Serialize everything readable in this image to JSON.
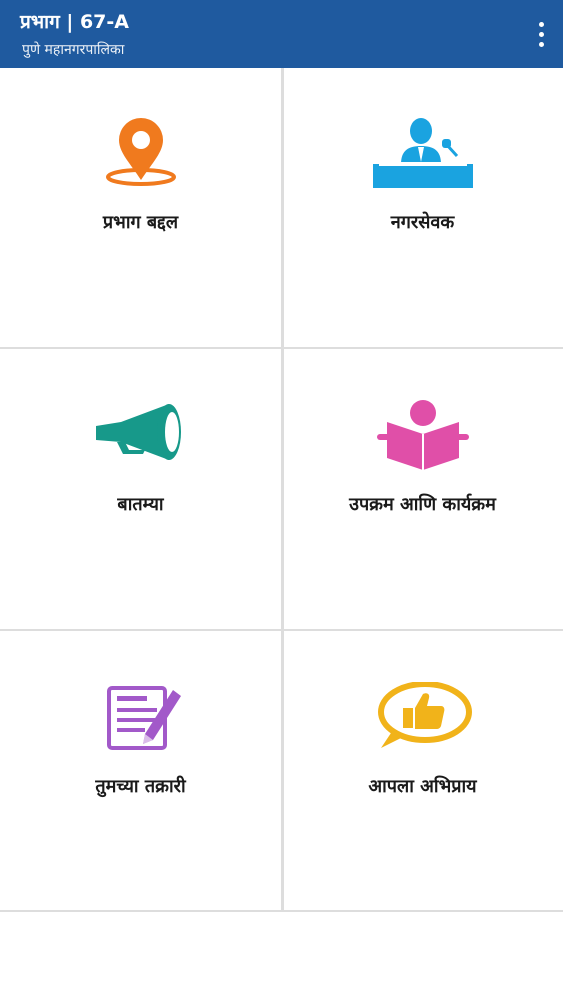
{
  "appbar": {
    "title": "प्रभाग | 67-A",
    "subtitle": "पुणे महानगरपालिका"
  },
  "tiles": [
    {
      "label": "प्रभाग बद्दल",
      "icon": "location-pin-icon",
      "color": "#f07a1e"
    },
    {
      "label": "नगरसेवक",
      "icon": "speaker-podium-icon",
      "color": "#1aa3e0"
    },
    {
      "label": "बातम्या",
      "icon": "megaphone-icon",
      "color": "#17998a"
    },
    {
      "label": "उपक्रम आणि कार्यक्रम",
      "icon": "reading-person-icon",
      "color": "#e04fa8"
    },
    {
      "label": "तुमच्या तक्रारी",
      "icon": "complaint-form-icon",
      "color": "#a259c9"
    },
    {
      "label": "आपला अभिप्राय",
      "icon": "thumbs-up-bubble-icon",
      "color": "#f1b31a"
    }
  ]
}
